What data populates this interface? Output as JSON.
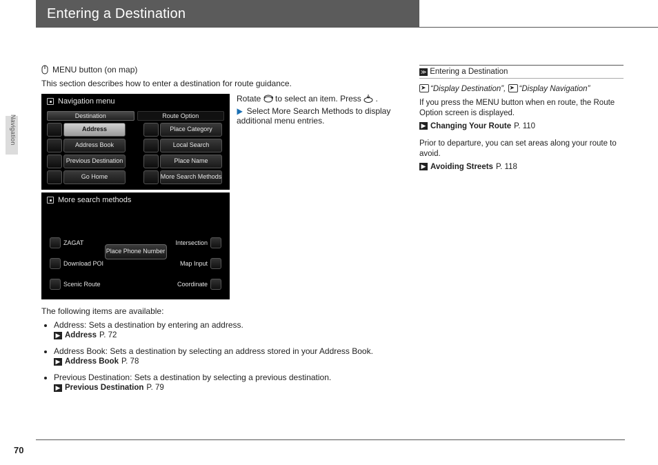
{
  "page": {
    "title": "Entering a Destination",
    "side_tab": "Navigation",
    "number": "70"
  },
  "main": {
    "menu_button_line": "MENU button (on map)",
    "intro": "This section describes how to enter a destination for route guidance.",
    "steps": {
      "rotate_a": "Rotate ",
      "rotate_b": " to select an item. Press ",
      "rotate_c": ".",
      "select_a": "Select ",
      "select_bold": "More Search Methods",
      "select_b": " to display additional menu entries."
    },
    "screen1": {
      "title": "Navigation menu",
      "tab_left": "Destination",
      "tab_right": "Route Option",
      "rows": [
        {
          "left": "Address",
          "right": "Place Category",
          "left_selected": true
        },
        {
          "left": "Address Book",
          "right": "Local Search"
        },
        {
          "left": "Previous Destination",
          "right": "Place Name"
        },
        {
          "left": "Go Home",
          "right": "More Search Methods"
        }
      ]
    },
    "screen2": {
      "title": "More search methods",
      "center": "Place Phone Number",
      "left": [
        "ZAGAT",
        "Download POI",
        "Scenic Route"
      ],
      "right": [
        "Intersection",
        "Map Input",
        "Coordinate"
      ]
    },
    "following": "The following items are available:",
    "items": [
      {
        "term": "Address",
        "desc": ": Sets a destination by entering an address.",
        "ref": "Address",
        "page": "P. 72"
      },
      {
        "term": "Address Book",
        "desc": ": Sets a destination by selecting an address stored in your Address Book.",
        "ref": "Address Book",
        "page": "P. 78"
      },
      {
        "term": "Previous Destination",
        "desc": ": Sets a destination by selecting a previous destination.",
        "ref": "Previous Destination",
        "page": "P. 79"
      }
    ]
  },
  "side": {
    "head": "Entering a Destination",
    "voice1": "“Display Destination”",
    "voice_sep": ", ",
    "voice2": "“Display Navigation”",
    "para1": "If you press the MENU button when en route, the Route Option screen is displayed.",
    "ref1": "Changing Your Route",
    "ref1_page": "P. 110",
    "para2": "Prior to departure, you can set areas along your route to avoid.",
    "ref2": "Avoiding Streets",
    "ref2_page": "P. 118"
  }
}
